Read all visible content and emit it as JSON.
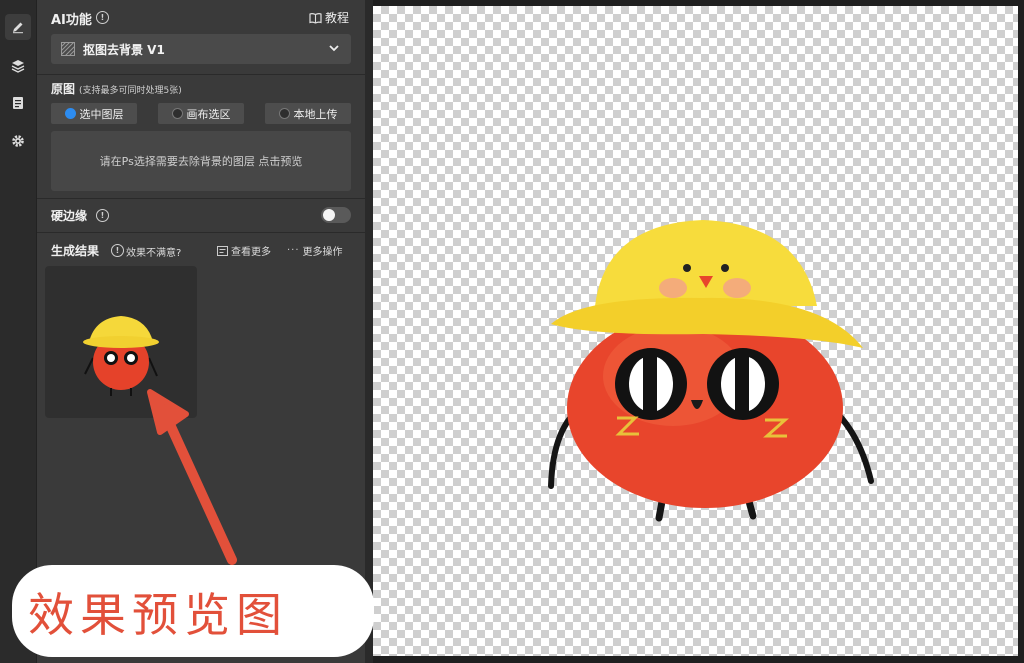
{
  "ai_section": {
    "title": "AI功能",
    "tutorial_label": "教程"
  },
  "feature_select": {
    "value": "抠图去背景 V1"
  },
  "source_section": {
    "title": "原图",
    "subtitle": "(支持最多可同时处理5张)",
    "options": [
      {
        "label": "选中图层",
        "selected": true
      },
      {
        "label": "画布选区",
        "selected": false
      },
      {
        "label": "本地上传",
        "selected": false
      }
    ],
    "hint": "请在Ps选择需要去除背景的图层 点击预览"
  },
  "hard_edge": {
    "label": "硬边缘",
    "enabled": false
  },
  "results": {
    "title": "生成结果",
    "unsatisfied_label": "效果不满意?",
    "view_more_label": "查看更多",
    "more_actions_label": "更多操作"
  },
  "annotation": {
    "text": "效果预览图",
    "color": "#e2503a"
  },
  "colors": {
    "panel": "#3a3a3a",
    "accent": "#2d8cf0",
    "canvas_check": "#cfcfcf"
  },
  "icons": {
    "sidebar": [
      "pen-icon",
      "layers-icon",
      "document-icon",
      "gear-icon"
    ],
    "tutorial": "book-icon",
    "select": "hatch-icon",
    "dropdown": "chevron-down-icon"
  }
}
